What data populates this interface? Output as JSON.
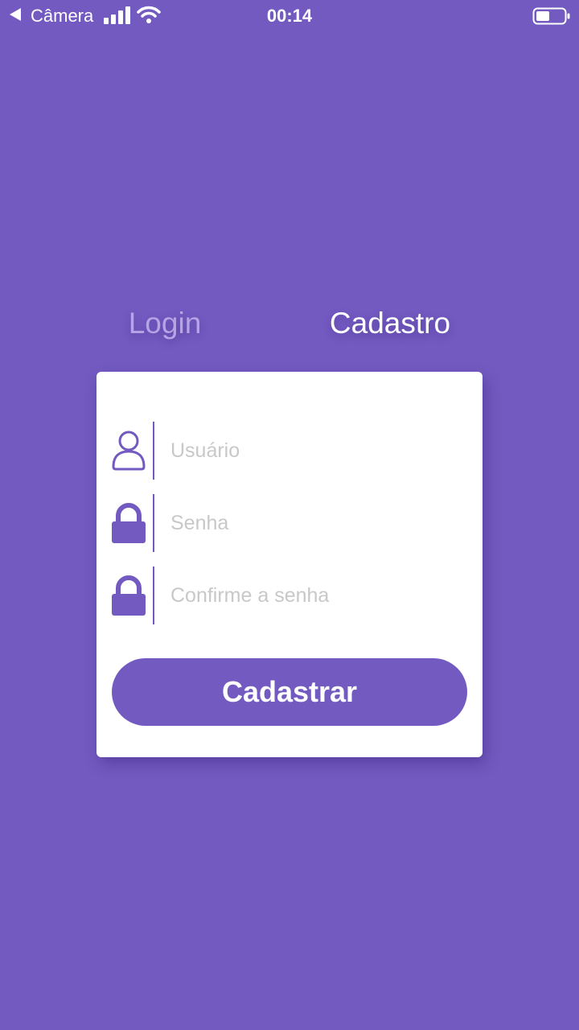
{
  "status_bar": {
    "back_app": "Câmera",
    "time": "00:14"
  },
  "colors": {
    "background": "#735ac1",
    "accent": "#735ac1",
    "card": "#ffffff",
    "tab_inactive": "#b3a5e6",
    "placeholder": "#c8c8c8"
  },
  "tabs": [
    {
      "label": "Login",
      "active": false
    },
    {
      "label": "Cadastro",
      "active": true
    }
  ],
  "form": {
    "fields": [
      {
        "icon": "user-icon",
        "placeholder": "Usuário",
        "value": ""
      },
      {
        "icon": "lock-icon",
        "placeholder": "Senha",
        "value": ""
      },
      {
        "icon": "lock-icon",
        "placeholder": "Confirme a senha",
        "value": ""
      }
    ],
    "submit_label": "Cadastrar"
  }
}
